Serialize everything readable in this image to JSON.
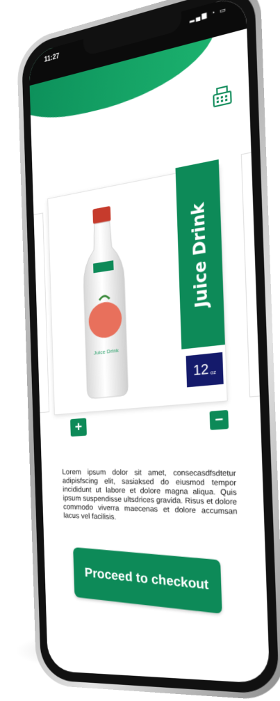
{
  "status": {
    "time": "11:27",
    "icons": "signal-wifi-battery"
  },
  "header": {
    "register_icon": "cash-register-icon",
    "accent": "#0d8a58"
  },
  "product": {
    "name": "Juice Drink",
    "bottle_label": "Juice Drink",
    "size_value": "12",
    "size_unit": "oz",
    "band_color": "#0d8a58",
    "badge_color": "#141a6b"
  },
  "quantity": {
    "plus_label": "+",
    "minus_label": "−"
  },
  "description": "Lorem ipsum dolor sit amet, consecasdfsdtetur adipisfscing elit, sasiaksed do eiusmod tempor incididunt ut labore et dolore magna aliqua. Quis ipsum suspendisse ultsdrices gravida. Risus et dolore commodo viverra maecenas et dolore accumsan lacus vel facilisis.",
  "checkout": {
    "label": "Proceed to checkout"
  }
}
